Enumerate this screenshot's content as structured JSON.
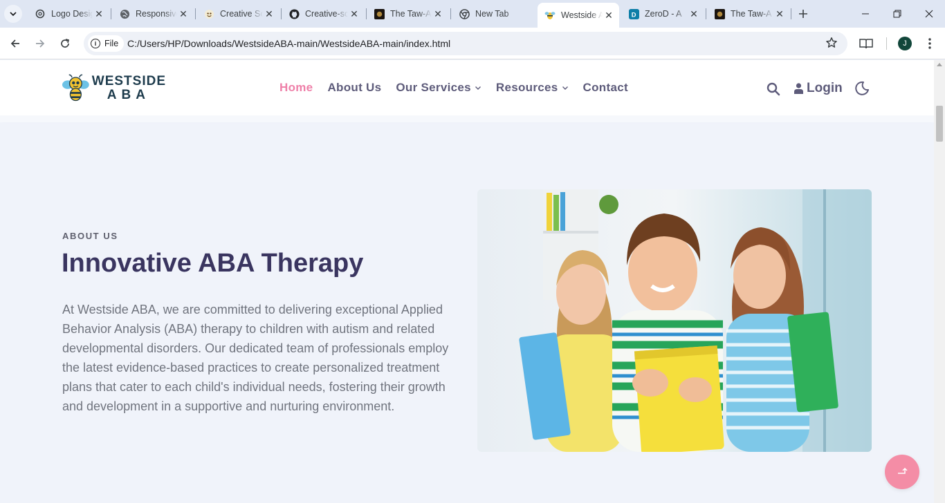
{
  "browser": {
    "tabs": [
      {
        "title": "Logo Design",
        "icon": "openai-icon"
      },
      {
        "title": "Responsive",
        "icon": "globe-icon"
      },
      {
        "title": "Creative Solutions",
        "icon": "creative-icon"
      },
      {
        "title": "Creative-solutions",
        "icon": "github-icon"
      },
      {
        "title": "The Taw-A",
        "icon": "taw-icon"
      },
      {
        "title": "New Tab",
        "icon": "chrome-icon"
      },
      {
        "title": "Westside ABA",
        "icon": "bee-icon",
        "active": true
      },
      {
        "title": "ZeroD - A",
        "icon": "zerod-icon"
      },
      {
        "title": "The Taw-A",
        "icon": "taw-icon"
      }
    ],
    "chip_label": "File",
    "url": "C:/Users/HP/Downloads/WestsideABA-main/WestsideABA-main/index.html",
    "profile_initial": "J"
  },
  "site": {
    "logo": {
      "line1": "WESTSIDE",
      "line2": "ABA"
    },
    "nav": {
      "home": "Home",
      "about": "About Us",
      "services": "Our Services",
      "resources": "Resources",
      "contact": "Contact"
    },
    "login_label": "Login",
    "colors": {
      "accent": "#ee7fa8",
      "heading": "#3a3560",
      "nav": "#5d5b7a",
      "background": "#f0f3fa"
    }
  },
  "about": {
    "eyebrow": "ABOUT US",
    "title": "Innovative ABA Therapy",
    "body": "At Westside ABA, we are committed to delivering exceptional Applied Behavior Analysis (ABA) therapy to children with autism and related developmental disorders. Our dedicated team of professionals employ the latest evidence-based practices to create personalized treatment plans that cater to each child's individual needs, fostering their growth and development in a supportive and nurturing environment."
  }
}
